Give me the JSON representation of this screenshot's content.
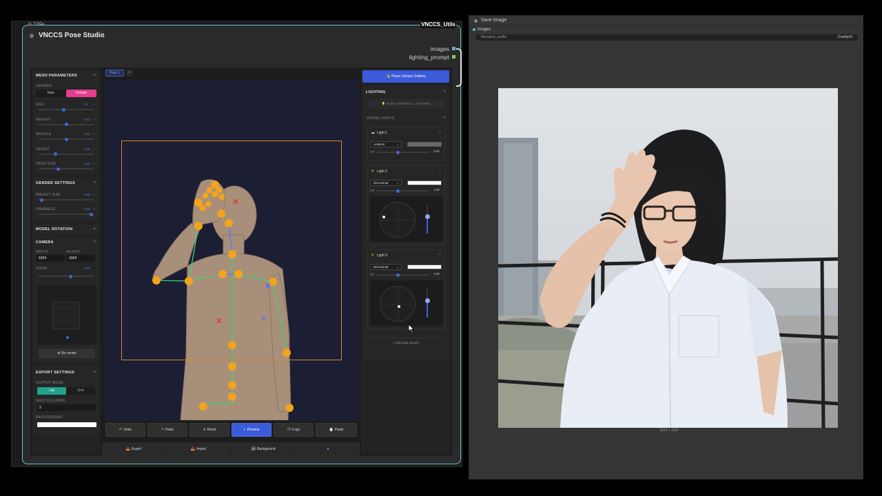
{
  "node": {
    "timing": "0.739s",
    "title": "VNCCS Pose Studio",
    "badge": "VNCCS_Utils",
    "outputs": [
      "images",
      "lighting_prompt"
    ]
  },
  "mesh": {
    "header": "MESH PARAMETERS",
    "gender_label": "GENDER",
    "male": "Male",
    "female": "Female",
    "sliders": [
      {
        "label": "AGE",
        "value": "25",
        "pos": 0.45
      },
      {
        "label": "WEIGHT",
        "value": "0.50",
        "pos": 0.5
      },
      {
        "label": "MUSCLE",
        "value": "0.50",
        "pos": 0.5
      },
      {
        "label": "HEIGHT",
        "value": "0.25",
        "pos": 0.3
      },
      {
        "label": "HEAD SIZE",
        "value": "1.00",
        "pos": 0.35
      }
    ]
  },
  "gender_settings": {
    "header": "GENDER SETTINGS",
    "sliders": [
      {
        "label": "BREAST SIZE",
        "value": "0.00",
        "pos": 0.05
      },
      {
        "label": "FIRMNESS",
        "value": "1.00",
        "pos": 0.95
      }
    ]
  },
  "model_rotation": {
    "header": "MODEL ROTATION"
  },
  "camera": {
    "header": "CAMERA",
    "width_label": "WIDTH",
    "height_label": "HEIGHT",
    "width": "1024",
    "height": "1024",
    "zoom_label": "ZOOM",
    "zoom_value": "1.00",
    "zoom_pos": 0.55,
    "recenter": "Re-center"
  },
  "export_settings": {
    "header": "EXPORT SETTINGS",
    "output_mode_label": "OUTPUT MODE",
    "mode_list": "List",
    "mode_grid": "Grid",
    "grid_columns_label": "GRID COLUMNS",
    "grid_columns": "2",
    "background_label": "BACKGROUND"
  },
  "viewport": {
    "tab": "Pose 1",
    "add_tab": "+"
  },
  "toolbar": {
    "undo": "Undo",
    "redo": "Redo",
    "reset": "Reset",
    "preview": "Preview",
    "copy": "Copy",
    "paste": "Paste"
  },
  "bottombar": {
    "export": "Export",
    "import": "Import",
    "background": "Background"
  },
  "lighting": {
    "library_button": "Pose Library Gallery",
    "header": "LIGHTING",
    "keep_original": "KEEP ORIGINAL LIGHTING",
    "scene_lights": "SCENE LIGHTS",
    "lights": [
      {
        "name": "Light 1",
        "type": "Ambient",
        "int_label": "Int",
        "int": "0.50",
        "int_pos": 0.4,
        "color": "#6a6a6a"
      },
      {
        "name": "Light 2",
        "type": "Directional",
        "int_label": "Int",
        "int": "1.00",
        "int_pos": 0.4,
        "color": "#ffffff"
      },
      {
        "name": "Light 3",
        "type": "Directional",
        "int_label": "Int",
        "int": "1.00",
        "int_pos": 0.4,
        "color": "#ffffff"
      }
    ],
    "add_light": "+ Add Light Source"
  },
  "save_image": {
    "title": "Save Image",
    "input_label": "images",
    "prefix_label": "filename_prefix",
    "prefix_value": "ComfyUI",
    "resolution": "1024 × 1024"
  },
  "colors": {
    "accent_blue": "#3b5bdb",
    "female_pink": "#e63e8f",
    "list_teal": "#1fa38c",
    "joint_orange": "#f3a41d",
    "node_border": "#6cc3cf"
  }
}
